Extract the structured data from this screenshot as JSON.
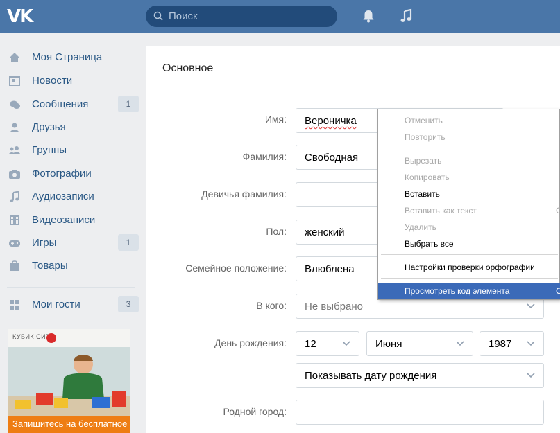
{
  "header": {
    "logo": "VK",
    "search_placeholder": "Поиск",
    "icons": [
      "search-icon",
      "bell-icon",
      "music-icon"
    ]
  },
  "sidebar": {
    "items": [
      {
        "label": "Моя Страница",
        "icon": "home-icon",
        "count": ""
      },
      {
        "label": "Новости",
        "icon": "news-icon",
        "count": ""
      },
      {
        "label": "Сообщения",
        "icon": "messages-icon",
        "count": "1"
      },
      {
        "label": "Друзья",
        "icon": "friends-icon",
        "count": ""
      },
      {
        "label": "Группы",
        "icon": "groups-icon",
        "count": ""
      },
      {
        "label": "Фотографии",
        "icon": "camera-icon",
        "count": ""
      },
      {
        "label": "Аудиозаписи",
        "icon": "music-icon",
        "count": ""
      },
      {
        "label": "Видеозаписи",
        "icon": "video-icon",
        "count": ""
      },
      {
        "label": "Игры",
        "icon": "gamepad-icon",
        "count": "1"
      },
      {
        "label": "Товары",
        "icon": "bag-icon",
        "count": ""
      }
    ],
    "guests": {
      "label": "Мои гости",
      "icon": "grid-icon",
      "count": "3"
    },
    "ad": {
      "brand": "КУБИК СИТИ",
      "caption": "Запишитесь на бесплатное"
    }
  },
  "main": {
    "title": "Основное",
    "fields": {
      "first_name": {
        "label": "Имя:",
        "value": "Вероничка"
      },
      "last_name": {
        "label": "Фамилия:",
        "value": "Свободная"
      },
      "maiden_name": {
        "label": "Девичья фамилия:",
        "value": ""
      },
      "gender": {
        "label": "Пол:",
        "value": "женский"
      },
      "relationship": {
        "label": "Семейное положение:",
        "value": "Влюблена"
      },
      "partner": {
        "label": "В кого:",
        "placeholder": "Не выбрано"
      },
      "birthday": {
        "label": "День рождения:",
        "day": "12",
        "month": "Июня",
        "year": "1987",
        "visibility": "Показывать дату рождения"
      },
      "hometown": {
        "label": "Родной город:",
        "value": ""
      }
    }
  },
  "context_menu": {
    "items": [
      {
        "label": "Отменить",
        "enabled": false,
        "shortcut": ""
      },
      {
        "label": "Повторить",
        "enabled": false,
        "shortcut": ""
      },
      {
        "label": "Вырезать",
        "enabled": false,
        "shortcut": ""
      },
      {
        "label": "Копировать",
        "enabled": false,
        "shortcut": ""
      },
      {
        "label": "Вставить",
        "enabled": true,
        "shortcut": ""
      },
      {
        "label": "Вставить как текст",
        "enabled": false,
        "shortcut": "С"
      },
      {
        "label": "Удалить",
        "enabled": false,
        "shortcut": ""
      },
      {
        "label": "Выбрать все",
        "enabled": true,
        "shortcut": ""
      },
      {
        "label": "Настройки проверки орфографии",
        "enabled": true,
        "shortcut": ""
      },
      {
        "label": "Просмотреть код элемента",
        "enabled": true,
        "selected": true,
        "shortcut": "С"
      }
    ]
  },
  "colors": {
    "header": "#4a76a8",
    "search": "#224b7a",
    "link": "#2a5885",
    "menu_selected": "#3b6ab8"
  }
}
